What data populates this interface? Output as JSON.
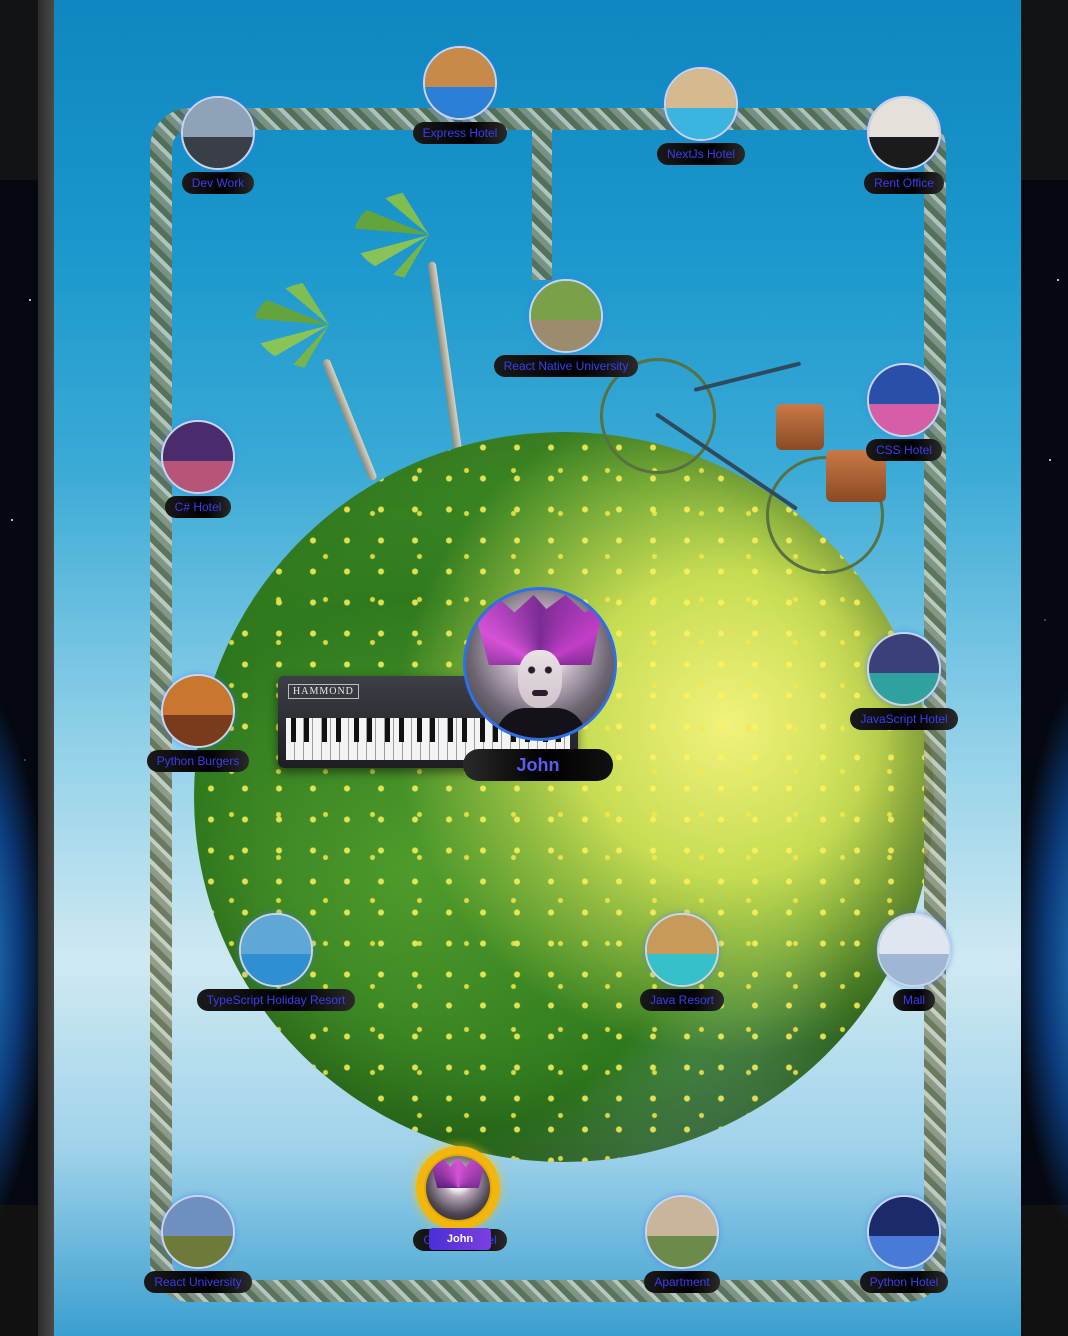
{
  "player": {
    "name": "John"
  },
  "token": {
    "name": "John"
  },
  "keyboard": {
    "brand": "HAMMOND"
  },
  "locations": [
    {
      "id": "dev-work",
      "label": "Dev Work",
      "colors": [
        "#8fa3b8",
        "#3a3f47"
      ]
    },
    {
      "id": "express-hotel",
      "label": "Express Hotel",
      "colors": [
        "#c88a4a",
        "#2b7fd6"
      ]
    },
    {
      "id": "nextjs-hotel",
      "label": "NextJs Hotel",
      "colors": [
        "#d7b98f",
        "#3bb4e0"
      ]
    },
    {
      "id": "rent-office",
      "label": "Rent Office",
      "colors": [
        "#e6e0da",
        "#1b1b1b"
      ]
    },
    {
      "id": "react-native-university",
      "label": "React Native University",
      "colors": [
        "#7aa14a",
        "#9d8b6e"
      ]
    },
    {
      "id": "csharp-hotel",
      "label": "C# Hotel",
      "colors": [
        "#4a2b6b",
        "#b8547a"
      ]
    },
    {
      "id": "css-hotel",
      "label": "CSS Hotel",
      "colors": [
        "#2a4fa8",
        "#d45fa6"
      ]
    },
    {
      "id": "python-burgers",
      "label": "Python Burgers",
      "colors": [
        "#c9772e",
        "#7a3a1c"
      ]
    },
    {
      "id": "javascript-hotel",
      "label": "JavaScript Hotel",
      "colors": [
        "#3b3f7a",
        "#2fa2a0"
      ]
    },
    {
      "id": "typescript-holiday-resort",
      "label": "TypeScript Holiday Resort",
      "colors": [
        "#5fa7d6",
        "#2f8fd0"
      ]
    },
    {
      "id": "java-resort",
      "label": "Java Resort",
      "colors": [
        "#c79a5a",
        "#36c0c9"
      ]
    },
    {
      "id": "mall",
      "label": "Mall",
      "colors": [
        "#dfe6ef",
        "#9fb7d4"
      ]
    },
    {
      "id": "react-university",
      "label": "React University",
      "colors": [
        "#6f8fc0",
        "#6e7a3a"
      ]
    },
    {
      "id": "gaming-hotel",
      "label": "Gaming Hotel",
      "colors": [
        "#4a3aa0",
        "#a88ac8"
      ]
    },
    {
      "id": "apartment",
      "label": "Apartment",
      "colors": [
        "#c8b59a",
        "#6c8a4a"
      ]
    },
    {
      "id": "python-hotel",
      "label": "Python Hotel",
      "colors": [
        "#1a2a6a",
        "#4a7ad8"
      ]
    }
  ]
}
